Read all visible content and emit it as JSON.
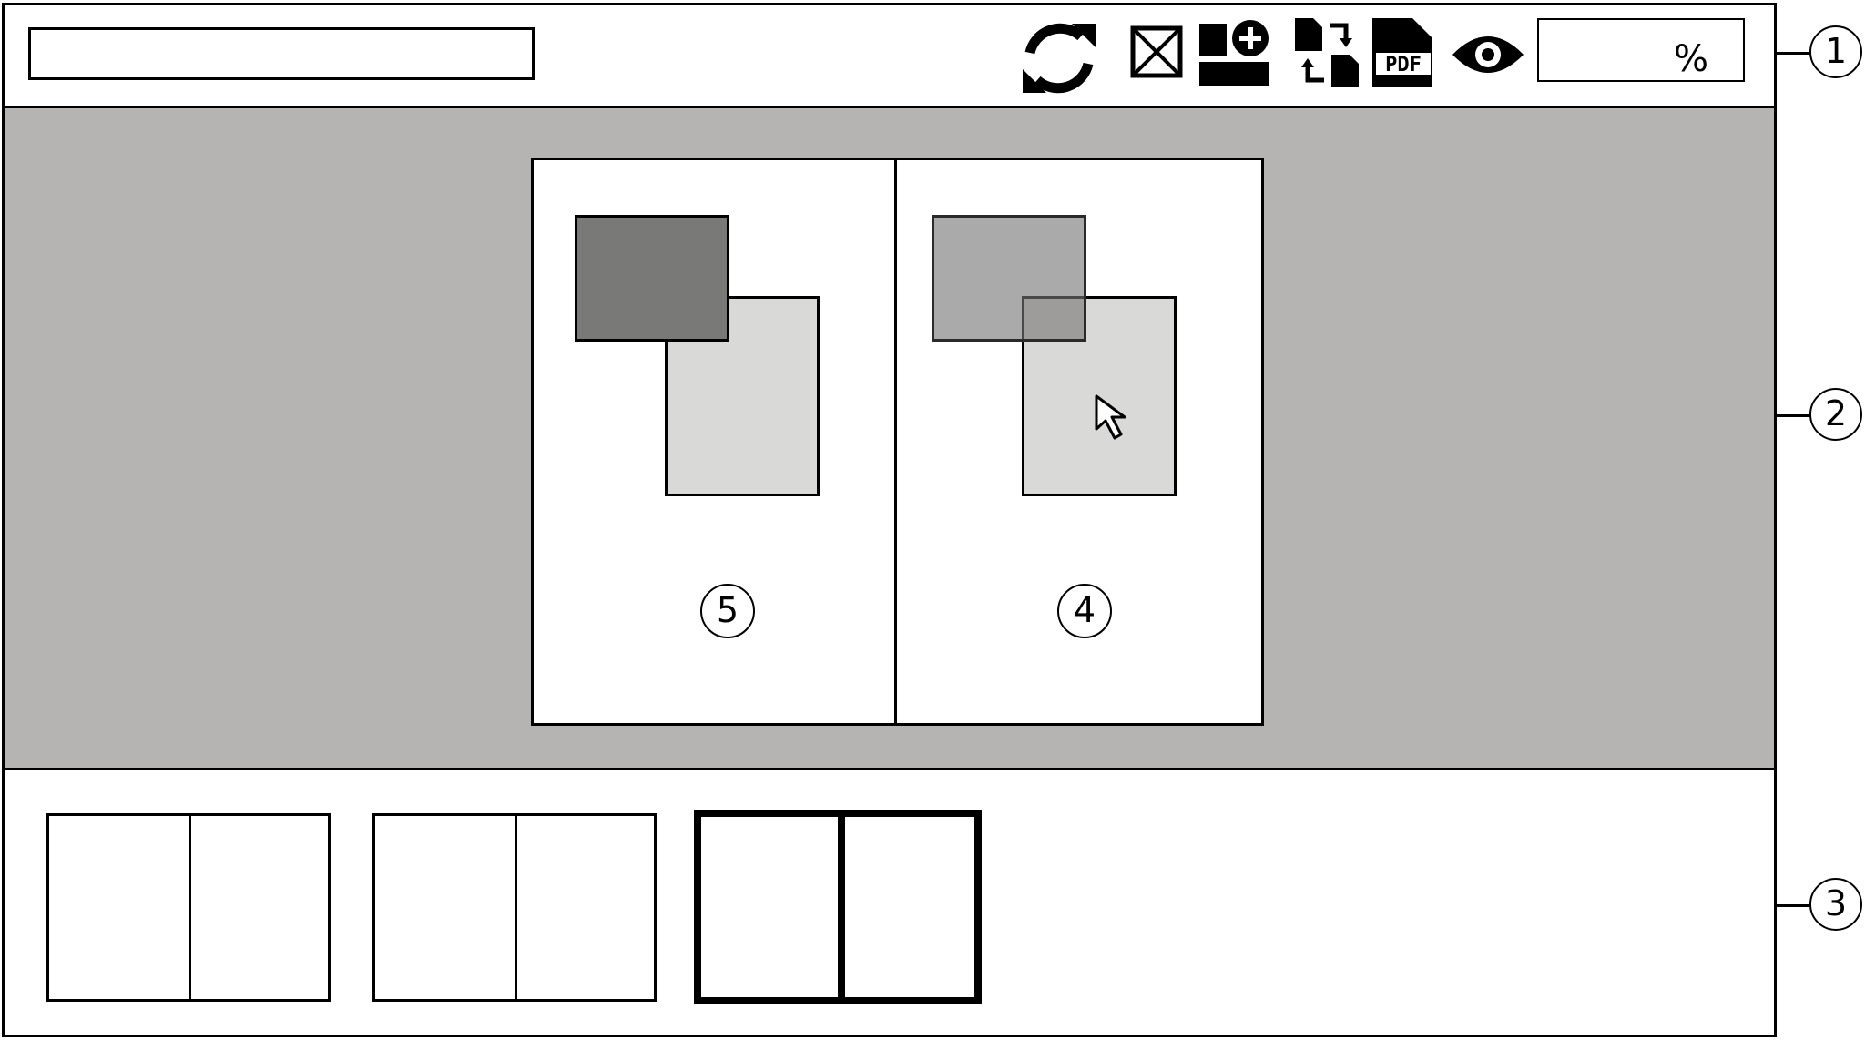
{
  "toolbar": {
    "title_value": "",
    "icons": [
      "refresh-icon",
      "close-box-icon",
      "add-layout-icon",
      "swap-pages-icon",
      "pdf-icon",
      "eye-icon"
    ],
    "zoom_suffix": "%"
  },
  "workspace": {
    "pages": [
      {
        "number": "5"
      },
      {
        "number": "4"
      }
    ]
  },
  "filmstrip": {
    "thumbnails": [
      {
        "selected": false
      },
      {
        "selected": false
      },
      {
        "selected": true
      }
    ]
  },
  "callouts": [
    "1",
    "2",
    "3"
  ],
  "colors": {
    "workspace_bg": "#b5b4b2",
    "dark_rect": "#797977",
    "dark_rect_translucent": "#a09e9e",
    "light_rect": "#d9d9d8"
  }
}
